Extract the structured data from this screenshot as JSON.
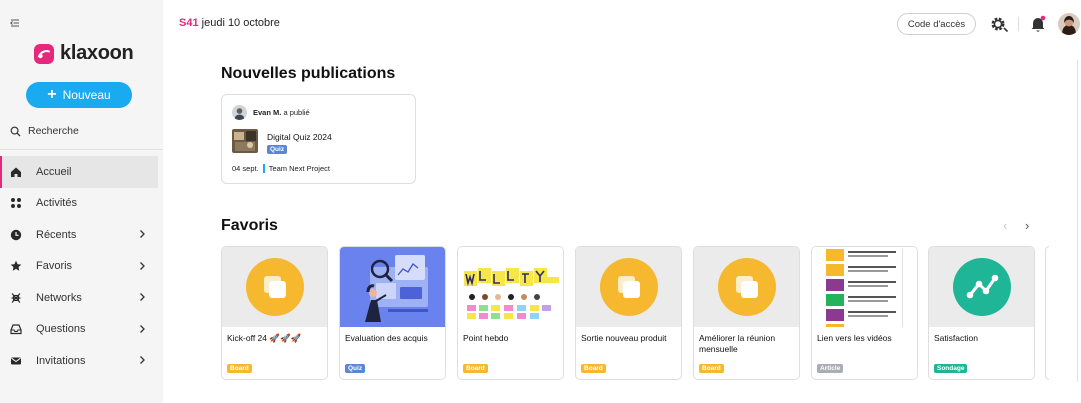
{
  "sidebar": {
    "logo_text": "klaxoon",
    "new_button": "Nouveau",
    "search_label": "Recherche",
    "items": [
      {
        "label": "Accueil",
        "icon": "home-icon",
        "active": true,
        "has_chevron": false
      },
      {
        "label": "Activités",
        "icon": "grid-icon",
        "active": false,
        "has_chevron": false
      },
      {
        "label": "Récents",
        "icon": "clock-icon",
        "active": false,
        "has_chevron": true
      },
      {
        "label": "Favoris",
        "icon": "star-icon",
        "active": false,
        "has_chevron": true
      },
      {
        "label": "Networks",
        "icon": "network-icon",
        "active": false,
        "has_chevron": true
      },
      {
        "label": "Questions",
        "icon": "inbox-icon",
        "active": false,
        "has_chevron": true
      },
      {
        "label": "Invitations",
        "icon": "mail-icon",
        "active": false,
        "has_chevron": true
      }
    ]
  },
  "header": {
    "week": "S41",
    "date": "jeudi 10 octobre",
    "access_code_button": "Code d'accès"
  },
  "publications": {
    "title": "Nouvelles publications",
    "card": {
      "author": "Evan M.",
      "action": "a publié",
      "title": "Digital Quiz 2024",
      "tag": "Quiz",
      "date": "04 sept.",
      "project": "Team Next Project"
    }
  },
  "favorites": {
    "title": "Favoris",
    "prev": "‹",
    "next": "›",
    "cards": [
      {
        "title": "Kick-off 24 🚀🚀🚀",
        "tag": "Board",
        "tag_color": "#f5b82e",
        "media": "board-icon"
      },
      {
        "title": "Evaluation des acquis",
        "tag": "Quiz",
        "tag_color": "#5b86d6",
        "media": "quiz-illustration"
      },
      {
        "title": "Point hebdo",
        "tag": "Board",
        "tag_color": "#f5b82e",
        "media": "weekly-board-image"
      },
      {
        "title": "Sortie nouveau produit",
        "tag": "Board",
        "tag_color": "#f5b82e",
        "media": "board-icon"
      },
      {
        "title": "Améliorer la réunion mensuelle",
        "tag": "Board",
        "tag_color": "#f5b82e",
        "media": "board-icon"
      },
      {
        "title": "Lien vers les vidéos",
        "tag": "Article",
        "tag_color": "#a9adb5",
        "media": "video-list-image"
      },
      {
        "title": "Satisfaction",
        "tag": "Sondage",
        "tag_color": "#1fb597",
        "media": "survey-icon"
      }
    ]
  },
  "colors": {
    "accent": "#e6287d",
    "primary": "#1aaaf0",
    "board": "#f5b82e",
    "survey": "#1fb597",
    "quiz": "#5b86d6"
  }
}
